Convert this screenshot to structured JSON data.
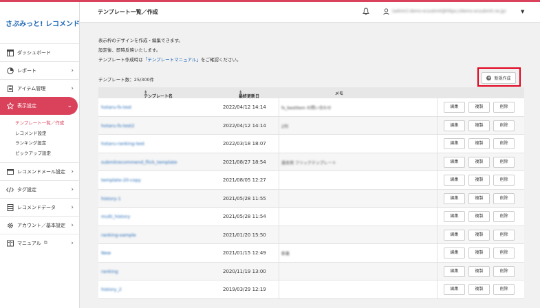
{
  "brand": {
    "logo_text": "さぶみっと! レコメンド",
    "accent": "#d9425a",
    "link_color": "#1a64b4"
  },
  "header": {
    "title": "テンプレート一覧／作成",
    "user_text": "[admin] demo-ecsubmit@https://demo-ecsubmit.ne.jp/",
    "bell_icon": "bell-icon",
    "user_icon": "user-icon"
  },
  "sidebar": {
    "items": [
      {
        "label": "ダッシュボード",
        "icon": "dashboard-icon",
        "chevron": false
      },
      {
        "label": "レポート",
        "icon": "pie-chart-icon",
        "chevron": true
      },
      {
        "label": "アイテム管理",
        "icon": "clipboard-icon",
        "chevron": true
      },
      {
        "label": "表示設定",
        "icon": "star-icon",
        "chevron": true,
        "active": true
      },
      {
        "label": "レコメンドメール設定",
        "icon": "mail-icon",
        "chevron": true
      },
      {
        "label": "タグ設定",
        "icon": "code-icon",
        "chevron": true
      },
      {
        "label": "レコメンドデータ",
        "icon": "database-icon",
        "chevron": true
      },
      {
        "label": "アカウント／基本設定",
        "icon": "gear-icon",
        "chevron": true
      },
      {
        "label": "マニュアル",
        "icon": "book-icon",
        "chevron": true
      }
    ],
    "subitems": [
      "テンプレート一覧／作成",
      "レコメンド設定",
      "ランキング設定",
      "ピックアップ設定"
    ]
  },
  "main": {
    "intro_line1": "表示枠のデザインを作成・編集できます。",
    "intro_line2": "設定後、即時反映いたします。",
    "intro_line3_prefix": "テンプレート作成時は",
    "intro_link": "「テンプレートマニュアル」",
    "intro_line3_suffix": "をご確認ください。",
    "count_label": "テンプレート数：25/300件",
    "new_button": "新規作成"
  },
  "table": {
    "headers": {
      "name": "テンプレート名",
      "date": "最終更新日",
      "memo": "メモ"
    },
    "actions": {
      "edit": "編集",
      "copy": "複製",
      "delete": "削除"
    },
    "rows": [
      {
        "name": "hotaru-fs-test",
        "date": "2022/04/12 14:14",
        "memo": "fs_bestItem の問い合わせ"
      },
      {
        "name": "hotaru-fs-test2",
        "date": "2022/04/12 14:14",
        "memo": "2列"
      },
      {
        "name": "hotaru-ranking-test",
        "date": "2022/03/18 18:07",
        "memo": ""
      },
      {
        "name": "submitrecommend_flick_template",
        "date": "2021/08/27 18:54",
        "memo": "過去用 フリックテンプレート"
      },
      {
        "name": "template-20-copy",
        "date": "2021/08/05 12:27",
        "memo": ""
      },
      {
        "name": "history-1",
        "date": "2021/05/28 11:55",
        "memo": ""
      },
      {
        "name": "multi_history",
        "date": "2021/05/28 11:54",
        "memo": ""
      },
      {
        "name": "ranking-sample",
        "date": "2021/01/20 15:50",
        "memo": ""
      },
      {
        "name": "New",
        "date": "2021/01/15 12:49",
        "memo": "新着"
      },
      {
        "name": "ranking",
        "date": "2020/11/19 13:00",
        "memo": ""
      },
      {
        "name": "history_2",
        "date": "2019/03/29 12:19",
        "memo": ""
      }
    ]
  }
}
